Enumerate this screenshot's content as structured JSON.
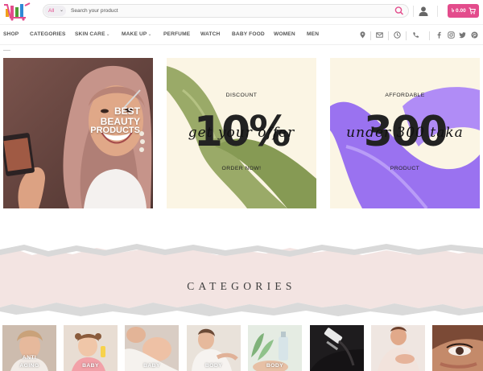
{
  "header": {
    "search_category": "All",
    "search_placeholder": "Search your product",
    "cart_total": "৳ 0.00"
  },
  "nav": {
    "items": [
      {
        "label": "SHOP",
        "dropdown": false
      },
      {
        "label": "CATEGORIES",
        "dropdown": false
      },
      {
        "label": "SKIN CARE",
        "dropdown": true
      },
      {
        "label": "MAKE UP",
        "dropdown": true
      },
      {
        "label": "PERFUME",
        "dropdown": false
      },
      {
        "label": "WATCH",
        "dropdown": false
      },
      {
        "label": "BABY FOOD",
        "dropdown": false
      },
      {
        "label": "WOMEN",
        "dropdown": false
      },
      {
        "label": "MEN",
        "dropdown": false
      }
    ],
    "contact_icons": [
      "location-icon",
      "mail-icon",
      "clock-icon",
      "phone-icon"
    ],
    "social_icons": [
      "facebook-icon",
      "instagram-icon",
      "twitter-icon",
      "pinterest-icon"
    ]
  },
  "banners": {
    "beauty": {
      "line1": "BEST",
      "line2": "BEAUTY",
      "line3": "PRODUCTS"
    },
    "discount": {
      "top": "DISCOUNT",
      "big": "10%",
      "script": "get your offer",
      "bottom": "ORDER NOW!"
    },
    "affordable": {
      "top": "AFFORDABLE",
      "big": "300",
      "script": "under 300 taka",
      "bottom": "PRODUCT"
    }
  },
  "categories": {
    "heading": "CATEGORIES",
    "items": [
      {
        "label_1": "ANTI",
        "label_2": "AGING"
      },
      {
        "label_1": "BABY",
        "label_2": ""
      },
      {
        "label_1": "BABY",
        "label_2": ""
      },
      {
        "label_1": "BODY",
        "label_2": ""
      },
      {
        "label_1": "BODY",
        "label_2": ""
      },
      {
        "label_1": "",
        "label_2": ""
      },
      {
        "label_1": "",
        "label_2": ""
      },
      {
        "label_1": "",
        "label_2": ""
      }
    ]
  },
  "colors": {
    "accent": "#e34c8c",
    "banner_cream": "#fbf5e4",
    "silk_green": "#9aaa68",
    "silk_purple": "#9a72f0",
    "category_band": "#f3e4e2"
  }
}
